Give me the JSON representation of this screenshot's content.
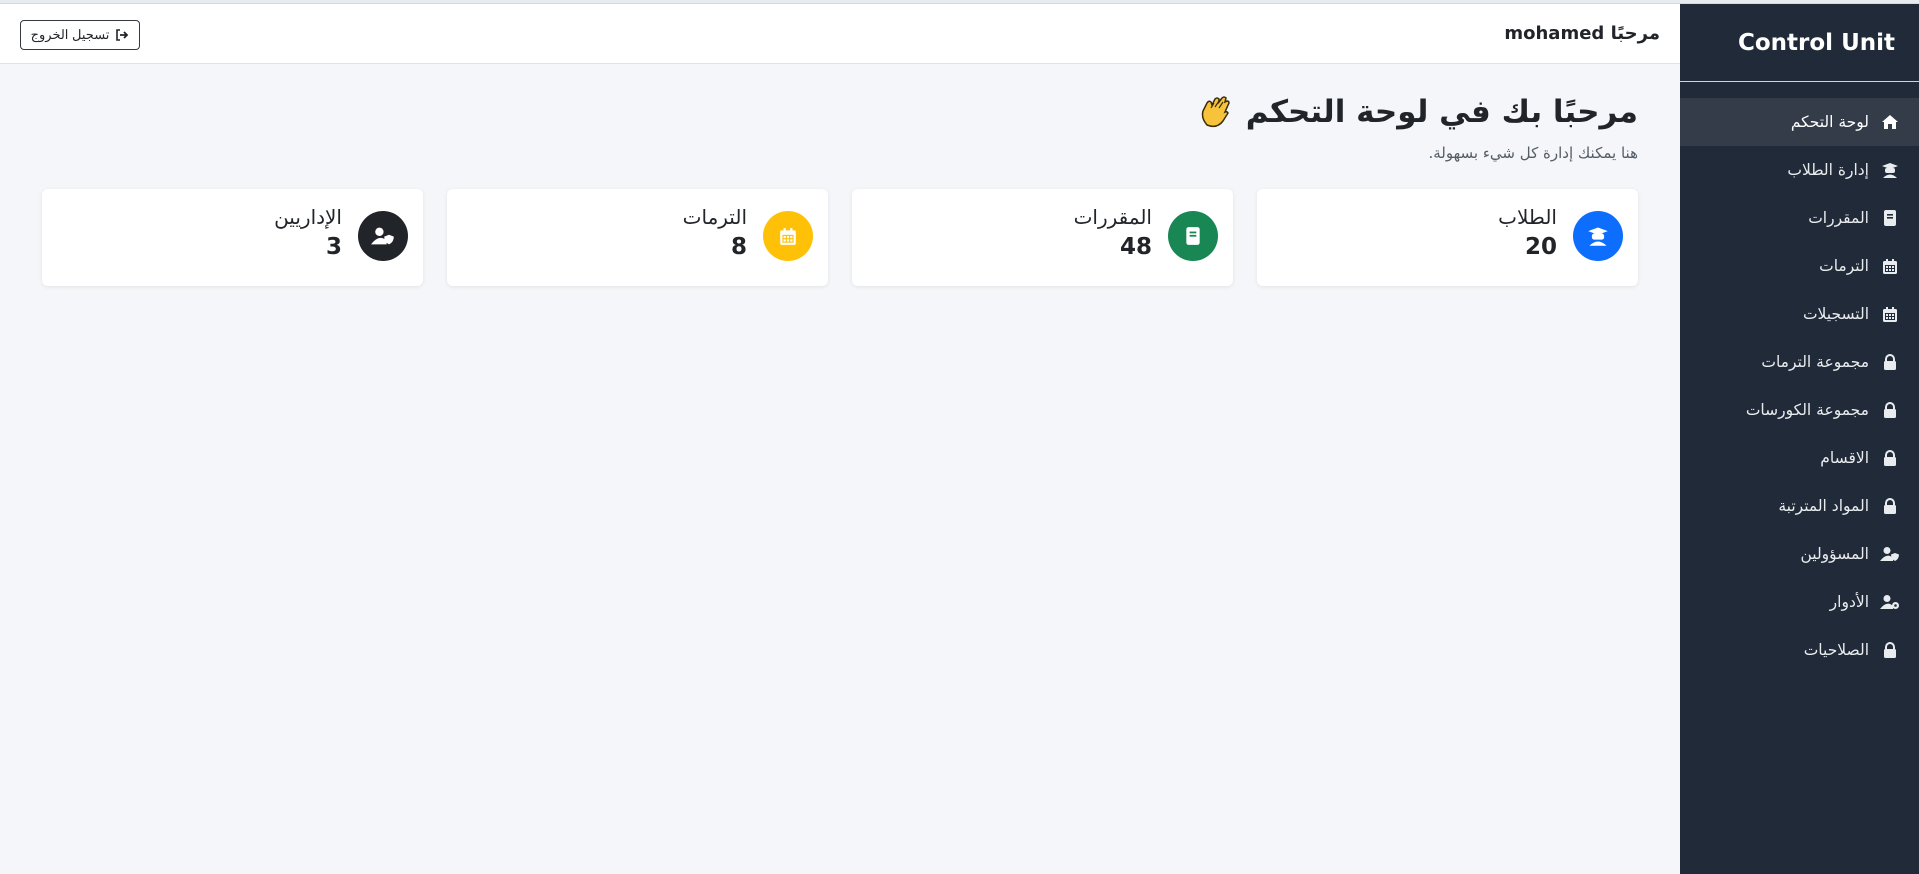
{
  "sidebar": {
    "brand": "Control Unit",
    "items": [
      {
        "label": "لوحة التحكم",
        "icon": "home-icon",
        "active": true
      },
      {
        "label": "إدارة الطلاب",
        "icon": "graduate-icon"
      },
      {
        "label": "المقررات",
        "icon": "book-icon"
      },
      {
        "label": "الترمات",
        "icon": "calendar-icon"
      },
      {
        "label": "التسجيلات",
        "icon": "calendar-icon"
      },
      {
        "label": "مجموعة الترمات",
        "icon": "lock-icon"
      },
      {
        "label": "مجموعة الكورسات",
        "icon": "lock-icon"
      },
      {
        "label": "الاقسام",
        "icon": "lock-icon"
      },
      {
        "label": "المواد المترتبة",
        "icon": "lock-icon"
      },
      {
        "label": "المسؤولين",
        "icon": "user-shield-icon"
      },
      {
        "label": "الأدوار",
        "icon": "user-gear-icon"
      },
      {
        "label": "الصلاحيات",
        "icon": "lock-icon"
      }
    ]
  },
  "header": {
    "greeting": "مرحبًا mohamed",
    "logout_label": "تسجيل الخروج"
  },
  "main": {
    "title": "مرحبًا بك في لوحة التحكم",
    "subtitle": "هنا يمكنك إدارة كل شيء بسهولة.",
    "cards": [
      {
        "title": "الطلاب",
        "value": "20",
        "icon": "graduate-icon",
        "color": "#0d6efd"
      },
      {
        "title": "المقررات",
        "value": "48",
        "icon": "book-icon",
        "color": "#198754"
      },
      {
        "title": "الترمات",
        "value": "8",
        "icon": "calendar-icon",
        "color": "#ffc107"
      },
      {
        "title": "الإداريين",
        "value": "3",
        "icon": "user-shield-icon",
        "color": "#212529"
      }
    ]
  },
  "colors": {
    "sidebar_bg": "#212a38",
    "active_item_bg": "#343c4a",
    "page_bg": "#f4f6f9"
  }
}
